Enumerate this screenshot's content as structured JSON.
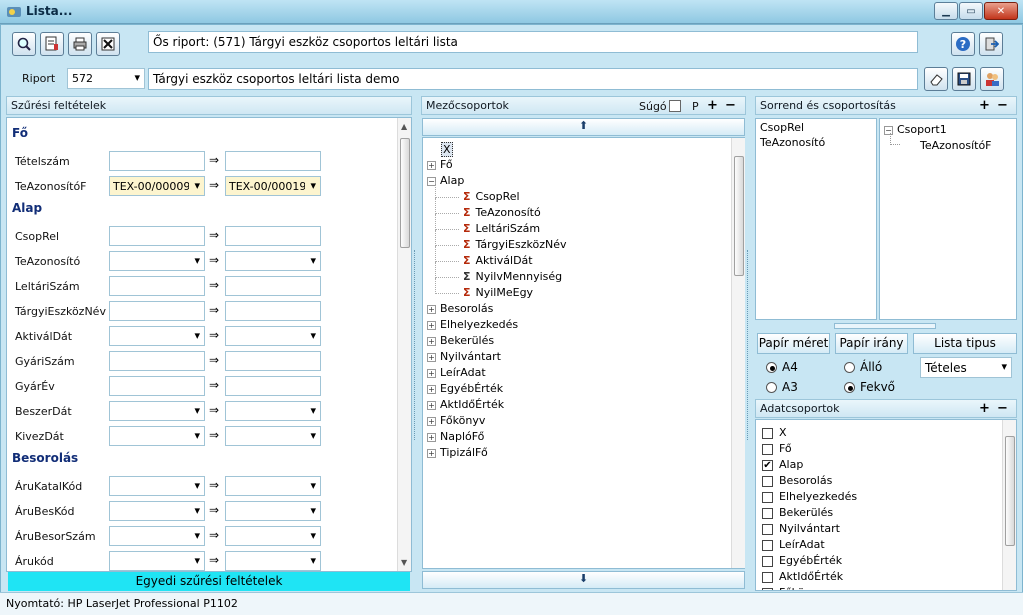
{
  "window": {
    "title": "Lista..."
  },
  "header": {
    "source_report": "Ős riport: (571)  Tárgyi eszköz csoportos leltári lista",
    "riport_label": "Riport",
    "riport_number": "572",
    "riport_name": "Tárgyi eszköz csoportos leltári lista demo"
  },
  "filters": {
    "title": "Szűrési feltételek",
    "sections": [
      {
        "name": "Fő",
        "rows": [
          {
            "label": "Tételszám",
            "from": "",
            "to": "",
            "dropdown": false
          },
          {
            "label": "TeAzonosítóF",
            "from": "TEX-00/00009",
            "to": "TEX-00/00019",
            "dropdown": true
          }
        ]
      },
      {
        "name": "Alap",
        "rows": [
          {
            "label": "CsopRel",
            "from": "",
            "to": "",
            "dropdown": false
          },
          {
            "label": "TeAzonosító",
            "from": "",
            "to": "",
            "dropdown": true
          },
          {
            "label": "LeltáriSzám",
            "from": "",
            "to": "",
            "dropdown": false
          },
          {
            "label": "TárgyiEszközNév",
            "from": "",
            "to": "",
            "dropdown": false
          },
          {
            "label": "AktiválDát",
            "from": "",
            "to": "",
            "dropdown": true
          },
          {
            "label": "GyáriSzám",
            "from": "",
            "to": "",
            "dropdown": false
          },
          {
            "label": "GyárÉv",
            "from": "",
            "to": "",
            "dropdown": false
          },
          {
            "label": "BeszerDát",
            "from": "",
            "to": "",
            "dropdown": true
          },
          {
            "label": "KivezDát",
            "from": "",
            "to": "",
            "dropdown": true
          }
        ]
      },
      {
        "name": "Besorolás",
        "rows": [
          {
            "label": "ÁruKatalKód",
            "from": "",
            "to": "",
            "dropdown": true
          },
          {
            "label": "ÁruBesKód",
            "from": "",
            "to": "",
            "dropdown": true
          },
          {
            "label": "ÁruBesorSzám",
            "from": "",
            "to": "",
            "dropdown": true
          },
          {
            "label": "Árukód",
            "from": "",
            "to": "",
            "dropdown": true
          }
        ]
      }
    ],
    "custom_button": "Egyedi szűrési feltételek"
  },
  "fieldgroups": {
    "title": "Mezőcsoportok",
    "help_label": "Súgó",
    "p_label": "P",
    "tree": [
      {
        "label": "X",
        "type": "x"
      },
      {
        "label": "Fő",
        "type": "group"
      },
      {
        "label": "Alap",
        "type": "open"
      },
      {
        "label": "CsopRel",
        "type": "sig"
      },
      {
        "label": "TeAzonosító",
        "type": "sig"
      },
      {
        "label": "LeltáriSzám",
        "type": "sig"
      },
      {
        "label": "TárgyiEszközNév",
        "type": "sig"
      },
      {
        "label": "AktiválDát",
        "type": "sig"
      },
      {
        "label": "NyilvMennyiség",
        "type": "sum"
      },
      {
        "label": "NyilMeEgy",
        "type": "sig"
      },
      {
        "label": "Besorolás",
        "type": "group"
      },
      {
        "label": "Elhelyezkedés",
        "type": "group"
      },
      {
        "label": "Bekerülés",
        "type": "group"
      },
      {
        "label": "Nyilvántart",
        "type": "group"
      },
      {
        "label": "LeírAdat",
        "type": "group"
      },
      {
        "label": "EgyébÉrték",
        "type": "group"
      },
      {
        "label": "AktIdőÉrték",
        "type": "group"
      },
      {
        "label": "Főkönyv",
        "type": "group"
      },
      {
        "label": "NaplóFő",
        "type": "group"
      },
      {
        "label": "TipizálFő",
        "type": "group"
      }
    ]
  },
  "ordering": {
    "title": "Sorrend és csoportosítás",
    "order_items": [
      "CsopRel",
      "TeAzonosító"
    ],
    "group_root": "Csoport1",
    "group_child": "TeAzonosítóF",
    "paper_size_label": "Papír méret",
    "paper_dir_label": "Papír irány",
    "list_type_label": "Lista tipus",
    "a4": "A4",
    "a3": "A3",
    "portrait": "Álló",
    "landscape": "Fekvő",
    "list_type_value": "Tételes"
  },
  "datagroups": {
    "title": "Adatcsoportok",
    "items": [
      {
        "label": "X",
        "checked": false
      },
      {
        "label": "Fő",
        "checked": false
      },
      {
        "label": "Alap",
        "checked": true
      },
      {
        "label": "Besorolás",
        "checked": false
      },
      {
        "label": "Elhelyezkedés",
        "checked": false
      },
      {
        "label": "Bekerülés",
        "checked": false
      },
      {
        "label": "Nyilvántart",
        "checked": false
      },
      {
        "label": "LeírAdat",
        "checked": false
      },
      {
        "label": "EgyébÉrték",
        "checked": false
      },
      {
        "label": "AktIdőÉrték",
        "checked": false
      },
      {
        "label": "Főkönyv",
        "checked": false
      }
    ]
  },
  "status": {
    "printer": "Nyomtató: HP LaserJet Professional P1102"
  }
}
